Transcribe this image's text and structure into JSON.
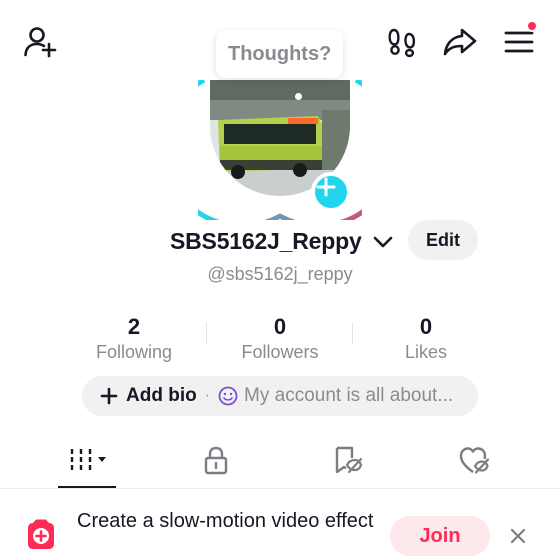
{
  "header": {
    "icons": [
      "add-friend-icon",
      "footprint-icon",
      "share-icon",
      "menu-icon"
    ],
    "notification_color": "#fe2c55"
  },
  "avatar": {
    "thoughts_prompt": "Thoughts?",
    "ring_colors": [
      "#20d5ec",
      "#fe2c55"
    ],
    "plus_color": "#20d5ec"
  },
  "profile": {
    "display_name": "SBS5162J_Reppy",
    "username": "@sbs5162j_reppy",
    "edit_label": "Edit"
  },
  "stats": [
    {
      "value": "2",
      "label": "Following"
    },
    {
      "value": "0",
      "label": "Followers"
    },
    {
      "value": "0",
      "label": "Likes"
    }
  ],
  "bio": {
    "add_label": "Add bio",
    "separator": "·",
    "placeholder": "My account is all about..."
  },
  "tabs": [
    "videos-grid-icon",
    "lock-icon",
    "repost-icon",
    "liked-icon"
  ],
  "banner": {
    "text": "Create a slow-motion video effect",
    "join_label": "Join",
    "accent": "#fe2c55"
  }
}
